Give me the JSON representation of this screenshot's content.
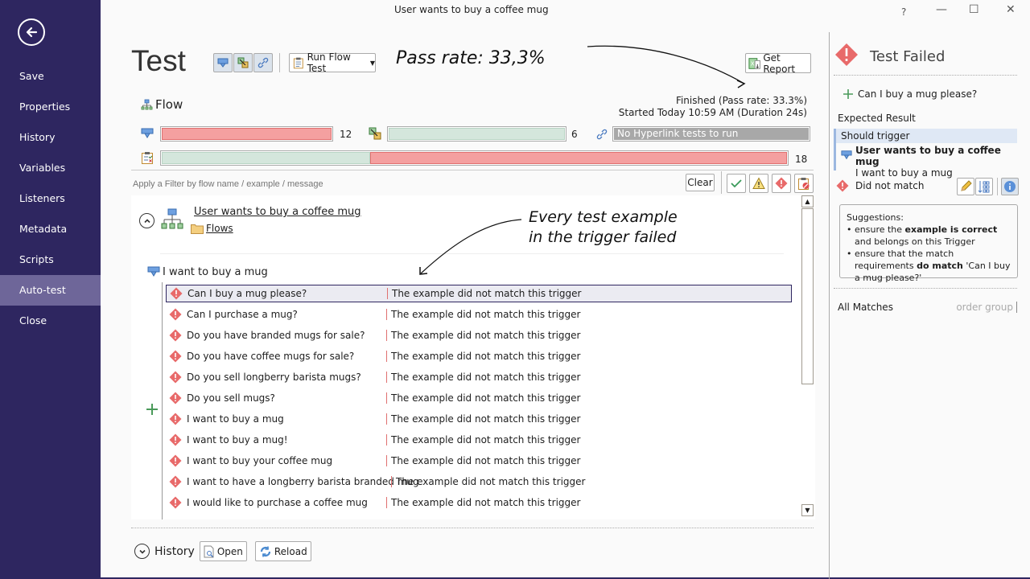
{
  "window": {
    "title": "User wants to buy a coffee mug",
    "controls": {
      "help": "?",
      "minimize": "—",
      "maximize": "☐",
      "close": "✕"
    }
  },
  "sidebar": {
    "back_icon": "arrow-left-circle",
    "items": [
      {
        "label": "Save"
      },
      {
        "label": "Properties"
      },
      {
        "label": "History"
      },
      {
        "label": "Variables"
      },
      {
        "label": "Listeners"
      },
      {
        "label": "Metadata"
      },
      {
        "label": "Scripts"
      },
      {
        "label": "Auto-test",
        "active": true
      },
      {
        "label": "Close"
      }
    ]
  },
  "header": {
    "title": "Test",
    "run_button": "Run Flow Test",
    "get_report": "Get Report",
    "status": "Finished (Pass rate: 33.3%)",
    "started": "Started Today 10:59 AM (Duration 24s)"
  },
  "annotations": {
    "pass_rate": "Pass rate: 33,3%",
    "every_failed_line1": "Every test example",
    "every_failed_line2": "in the trigger failed"
  },
  "flow": {
    "label": "Flow",
    "bars": {
      "trigger": {
        "count": "12",
        "pass_fraction": 0.0
      },
      "output": {
        "count": "6",
        "pass_fraction": 1.0
      },
      "hyperlink": {
        "text": "No Hyperlink tests to run"
      },
      "total": {
        "count": "18",
        "pass_fraction": 0.333
      }
    }
  },
  "filter": {
    "placeholder": "Apply a Filter by flow name / example / message",
    "clear": "Clear"
  },
  "results": {
    "flow_name": "User wants to buy a coffee mug",
    "folder": "Flows",
    "trigger": "I want to buy a mug",
    "rows": [
      {
        "example": "Can I buy a mug please?",
        "message": "The example did not match this trigger"
      },
      {
        "example": "Can I purchase a mug?",
        "message": "The example did not match this trigger"
      },
      {
        "example": "Do you have branded mugs for sale?",
        "message": "The example did not match this trigger"
      },
      {
        "example": "Do you have coffee mugs for sale?",
        "message": "The example did not match this trigger"
      },
      {
        "example": "Do you sell longberry barista mugs?",
        "message": "The example did not match this trigger"
      },
      {
        "example": "Do you sell mugs?",
        "message": "The example did not match this trigger"
      },
      {
        "example": "I want to buy a mug",
        "message": "The example did not match this trigger"
      },
      {
        "example": "I want to buy a mug!",
        "message": "The example did not match this trigger"
      },
      {
        "example": "I want to buy your coffee mug",
        "message": "The example did not match this trigger"
      },
      {
        "example": "I want to have a longberry barista branded mug",
        "message": "The example did not match this trigger"
      },
      {
        "example": "I would like to purchase a coffee mug",
        "message": "The example did not match this trigger"
      }
    ]
  },
  "history": {
    "label": "History",
    "open": "Open",
    "reload": "Reload"
  },
  "detail": {
    "title": "Test Failed",
    "example": "Can I buy a mug please?",
    "expected_label": "Expected Result",
    "should_trigger": "Should trigger",
    "expected_flow": "User wants to buy a coffee mug",
    "expected_trigger": "I want to buy a mug",
    "result": "Did not match",
    "suggestions_title": "Suggestions:",
    "s1_pre": "ensure the ",
    "s1_bold": "example is correct",
    "s1_post": " and belongs on this Trigger",
    "s2_pre": "ensure that the match requirements ",
    "s2_bold": "do match",
    "s2_post": " 'Can I buy a mug please?'",
    "all_matches": "All Matches",
    "order_group": "order group"
  },
  "colors": {
    "sidebar": "#2e2660",
    "sidebar_active": "#6e6699",
    "fail": "#f4a0a0",
    "pass": "#d4e6dc",
    "neutral": "#a8a8a8"
  }
}
